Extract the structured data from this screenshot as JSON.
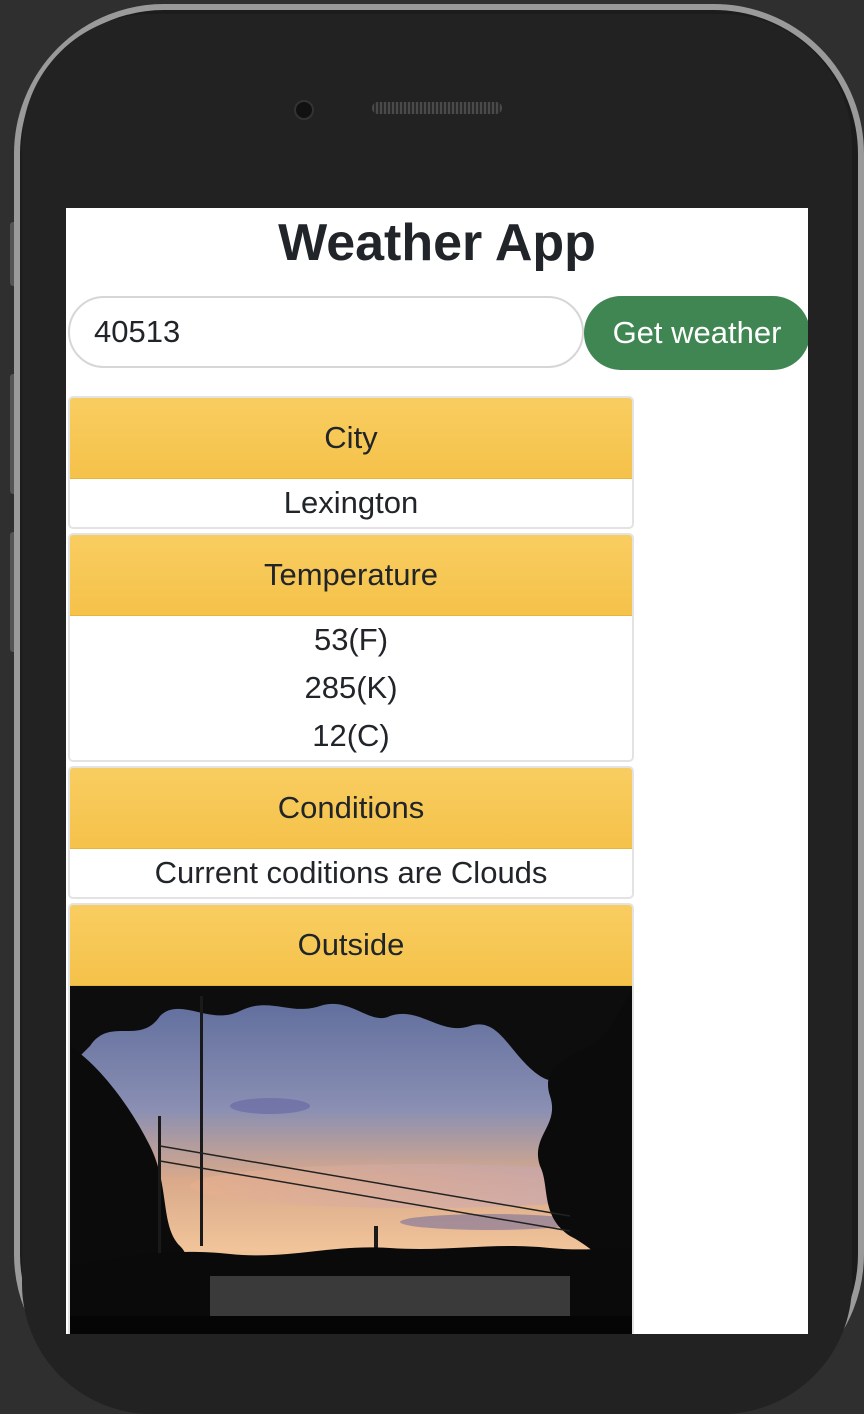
{
  "app": {
    "title": "Weather App"
  },
  "search": {
    "zip_value": "40513",
    "button_label": "Get weather"
  },
  "cards": {
    "city": {
      "header": "City",
      "value": "Lexington"
    },
    "temperature": {
      "header": "Temperature",
      "fahrenheit": "53(F)",
      "kelvin": "285(K)",
      "celsius": "12(C)"
    },
    "conditions": {
      "header": "Conditions",
      "value": "Current coditions are Clouds"
    },
    "outside": {
      "header": "Outside"
    }
  },
  "colors": {
    "button_green": "#3f8653",
    "header_yellow": "#f6c651",
    "phone_body": "#1c1c1c"
  },
  "icons": {
    "camera": "front-camera-icon",
    "speaker": "earpiece-speaker-icon"
  }
}
